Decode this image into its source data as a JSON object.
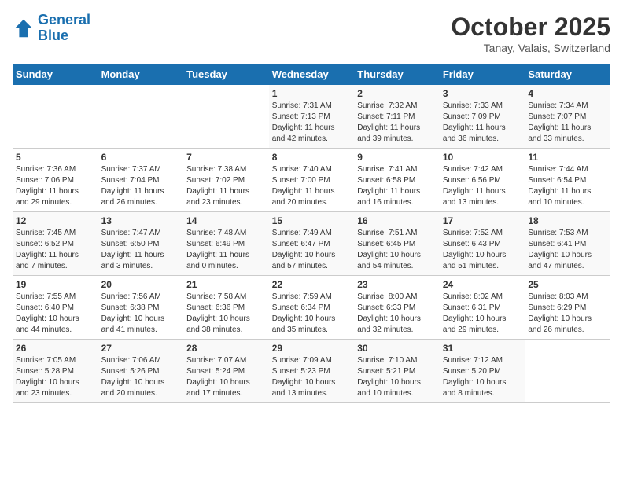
{
  "header": {
    "logo_line1": "General",
    "logo_line2": "Blue",
    "month": "October 2025",
    "location": "Tanay, Valais, Switzerland"
  },
  "weekdays": [
    "Sunday",
    "Monday",
    "Tuesday",
    "Wednesday",
    "Thursday",
    "Friday",
    "Saturday"
  ],
  "weeks": [
    [
      {
        "day": "",
        "info": ""
      },
      {
        "day": "",
        "info": ""
      },
      {
        "day": "",
        "info": ""
      },
      {
        "day": "1",
        "info": "Sunrise: 7:31 AM\nSunset: 7:13 PM\nDaylight: 11 hours\nand 42 minutes."
      },
      {
        "day": "2",
        "info": "Sunrise: 7:32 AM\nSunset: 7:11 PM\nDaylight: 11 hours\nand 39 minutes."
      },
      {
        "day": "3",
        "info": "Sunrise: 7:33 AM\nSunset: 7:09 PM\nDaylight: 11 hours\nand 36 minutes."
      },
      {
        "day": "4",
        "info": "Sunrise: 7:34 AM\nSunset: 7:07 PM\nDaylight: 11 hours\nand 33 minutes."
      }
    ],
    [
      {
        "day": "5",
        "info": "Sunrise: 7:36 AM\nSunset: 7:06 PM\nDaylight: 11 hours\nand 29 minutes."
      },
      {
        "day": "6",
        "info": "Sunrise: 7:37 AM\nSunset: 7:04 PM\nDaylight: 11 hours\nand 26 minutes."
      },
      {
        "day": "7",
        "info": "Sunrise: 7:38 AM\nSunset: 7:02 PM\nDaylight: 11 hours\nand 23 minutes."
      },
      {
        "day": "8",
        "info": "Sunrise: 7:40 AM\nSunset: 7:00 PM\nDaylight: 11 hours\nand 20 minutes."
      },
      {
        "day": "9",
        "info": "Sunrise: 7:41 AM\nSunset: 6:58 PM\nDaylight: 11 hours\nand 16 minutes."
      },
      {
        "day": "10",
        "info": "Sunrise: 7:42 AM\nSunset: 6:56 PM\nDaylight: 11 hours\nand 13 minutes."
      },
      {
        "day": "11",
        "info": "Sunrise: 7:44 AM\nSunset: 6:54 PM\nDaylight: 11 hours\nand 10 minutes."
      }
    ],
    [
      {
        "day": "12",
        "info": "Sunrise: 7:45 AM\nSunset: 6:52 PM\nDaylight: 11 hours\nand 7 minutes."
      },
      {
        "day": "13",
        "info": "Sunrise: 7:47 AM\nSunset: 6:50 PM\nDaylight: 11 hours\nand 3 minutes."
      },
      {
        "day": "14",
        "info": "Sunrise: 7:48 AM\nSunset: 6:49 PM\nDaylight: 11 hours\nand 0 minutes."
      },
      {
        "day": "15",
        "info": "Sunrise: 7:49 AM\nSunset: 6:47 PM\nDaylight: 10 hours\nand 57 minutes."
      },
      {
        "day": "16",
        "info": "Sunrise: 7:51 AM\nSunset: 6:45 PM\nDaylight: 10 hours\nand 54 minutes."
      },
      {
        "day": "17",
        "info": "Sunrise: 7:52 AM\nSunset: 6:43 PM\nDaylight: 10 hours\nand 51 minutes."
      },
      {
        "day": "18",
        "info": "Sunrise: 7:53 AM\nSunset: 6:41 PM\nDaylight: 10 hours\nand 47 minutes."
      }
    ],
    [
      {
        "day": "19",
        "info": "Sunrise: 7:55 AM\nSunset: 6:40 PM\nDaylight: 10 hours\nand 44 minutes."
      },
      {
        "day": "20",
        "info": "Sunrise: 7:56 AM\nSunset: 6:38 PM\nDaylight: 10 hours\nand 41 minutes."
      },
      {
        "day": "21",
        "info": "Sunrise: 7:58 AM\nSunset: 6:36 PM\nDaylight: 10 hours\nand 38 minutes."
      },
      {
        "day": "22",
        "info": "Sunrise: 7:59 AM\nSunset: 6:34 PM\nDaylight: 10 hours\nand 35 minutes."
      },
      {
        "day": "23",
        "info": "Sunrise: 8:00 AM\nSunset: 6:33 PM\nDaylight: 10 hours\nand 32 minutes."
      },
      {
        "day": "24",
        "info": "Sunrise: 8:02 AM\nSunset: 6:31 PM\nDaylight: 10 hours\nand 29 minutes."
      },
      {
        "day": "25",
        "info": "Sunrise: 8:03 AM\nSunset: 6:29 PM\nDaylight: 10 hours\nand 26 minutes."
      }
    ],
    [
      {
        "day": "26",
        "info": "Sunrise: 7:05 AM\nSunset: 5:28 PM\nDaylight: 10 hours\nand 23 minutes."
      },
      {
        "day": "27",
        "info": "Sunrise: 7:06 AM\nSunset: 5:26 PM\nDaylight: 10 hours\nand 20 minutes."
      },
      {
        "day": "28",
        "info": "Sunrise: 7:07 AM\nSunset: 5:24 PM\nDaylight: 10 hours\nand 17 minutes."
      },
      {
        "day": "29",
        "info": "Sunrise: 7:09 AM\nSunset: 5:23 PM\nDaylight: 10 hours\nand 13 minutes."
      },
      {
        "day": "30",
        "info": "Sunrise: 7:10 AM\nSunset: 5:21 PM\nDaylight: 10 hours\nand 10 minutes."
      },
      {
        "day": "31",
        "info": "Sunrise: 7:12 AM\nSunset: 5:20 PM\nDaylight: 10 hours\nand 8 minutes."
      },
      {
        "day": "",
        "info": ""
      }
    ]
  ]
}
